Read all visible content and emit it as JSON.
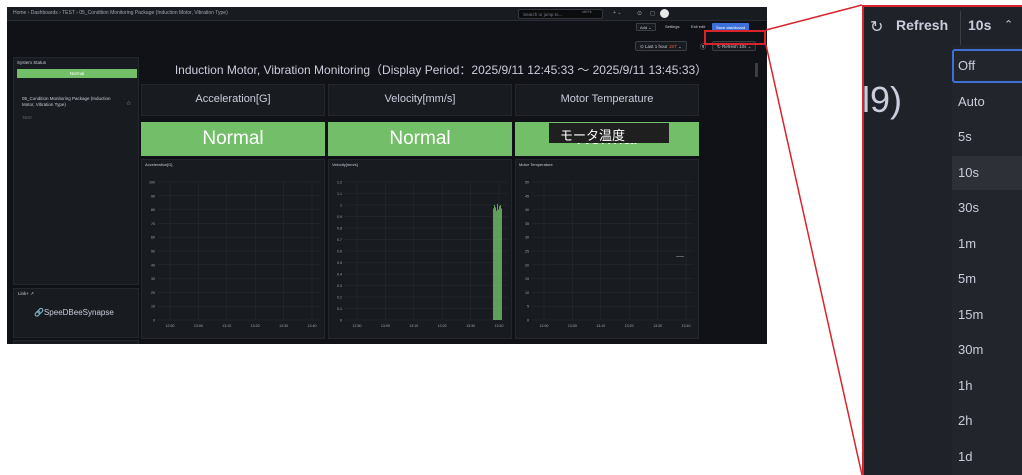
{
  "topbar": {
    "breadcrumb": "Home › Dashboards › TEST › 05_Condition Monitoring Package (Induction Motor, Vibration Type)",
    "search_placeholder": "Search or jump to...",
    "search_shortcut": "ctrl+k",
    "plus_label": "+ ⌄",
    "add_label": "Add ⌄",
    "settings_label": "Settings",
    "exit_label": "Exit edit",
    "save_label": "Save dashboard"
  },
  "timebar": {
    "range_label": "Last 1 hour",
    "timezone": "JST",
    "refresh_label": "Refresh",
    "refresh_interval": "10s"
  },
  "sidebar": {
    "system_status_title": "System Status",
    "system_status_value": "Normal",
    "package_item": "05_Condition Monitoring Package (Induction Motor, Vibration Type)",
    "package_folder": "TEST",
    "link_title": "Link+",
    "link_text": "SpeeDBeeSynapse"
  },
  "main": {
    "title": "Induction Motor, Vibration Monitoring（Display Period：2025/9/11 12:45:33 ～ 2025/9/11 13:45:33）",
    "panels": [
      {
        "header": "Acceleration[G]",
        "status": "Normal",
        "chart_title": "Acceleration[G]"
      },
      {
        "header": "Velocity[mm/s]",
        "status": "Normal",
        "chart_title": "Velocity[mm/s]"
      },
      {
        "header": "Motor Temperature",
        "status": "Normal",
        "chart_title": "Motor Temperature"
      }
    ],
    "tooltip": "モータ温度"
  },
  "chart_data": [
    {
      "type": "line",
      "title": "Acceleration[G]",
      "x_ticks": [
        "12:50",
        "13:00",
        "13:10",
        "13:20",
        "13:30",
        "13:40"
      ],
      "y_ticks": [
        "0",
        "10",
        "20",
        "30",
        "40",
        "50",
        "60",
        "70",
        "80",
        "90",
        "100"
      ],
      "ylim": [
        0,
        100
      ],
      "series": []
    },
    {
      "type": "bar",
      "title": "Velocity[mm/s]",
      "x_ticks": [
        "12:50",
        "13:00",
        "13:10",
        "13:20",
        "13:30",
        "13:40"
      ],
      "y_ticks": [
        "0",
        "0.1",
        "0.2",
        "0.3",
        "0.4",
        "0.5",
        "0.6",
        "0.7",
        "0.8",
        "0.9",
        "1",
        "1.1",
        "1.2"
      ],
      "ylim": [
        0,
        1.2
      ],
      "values": [
        0.97,
        1.0,
        0.98,
        0.95,
        1.01,
        0.96,
        0.99,
        1.0,
        0.97
      ],
      "color": "#73bf69"
    },
    {
      "type": "line",
      "title": "Motor Temperature",
      "x_ticks": [
        "12:50",
        "13:00",
        "13:10",
        "13:20",
        "13:30",
        "13:40"
      ],
      "y_ticks": [
        "0",
        "5",
        "10",
        "15",
        "20",
        "25",
        "30",
        "35",
        "40",
        "45",
        "50"
      ],
      "ylim": [
        0,
        50
      ],
      "series": [
        {
          "values": [
            23,
            23
          ]
        }
      ]
    }
  ],
  "zoom": {
    "refresh_label": "Refresh",
    "interval": "10s",
    "bg_text": "l9)",
    "options": [
      "Off",
      "Auto",
      "5s",
      "10s",
      "30s",
      "1m",
      "5m",
      "15m",
      "30m",
      "1h",
      "2h",
      "1d"
    ],
    "focused": "Off",
    "selected": "10s"
  },
  "colors": {
    "accent": "#d9242c",
    "ok": "#73bf69",
    "primary": "#3d71d9"
  }
}
